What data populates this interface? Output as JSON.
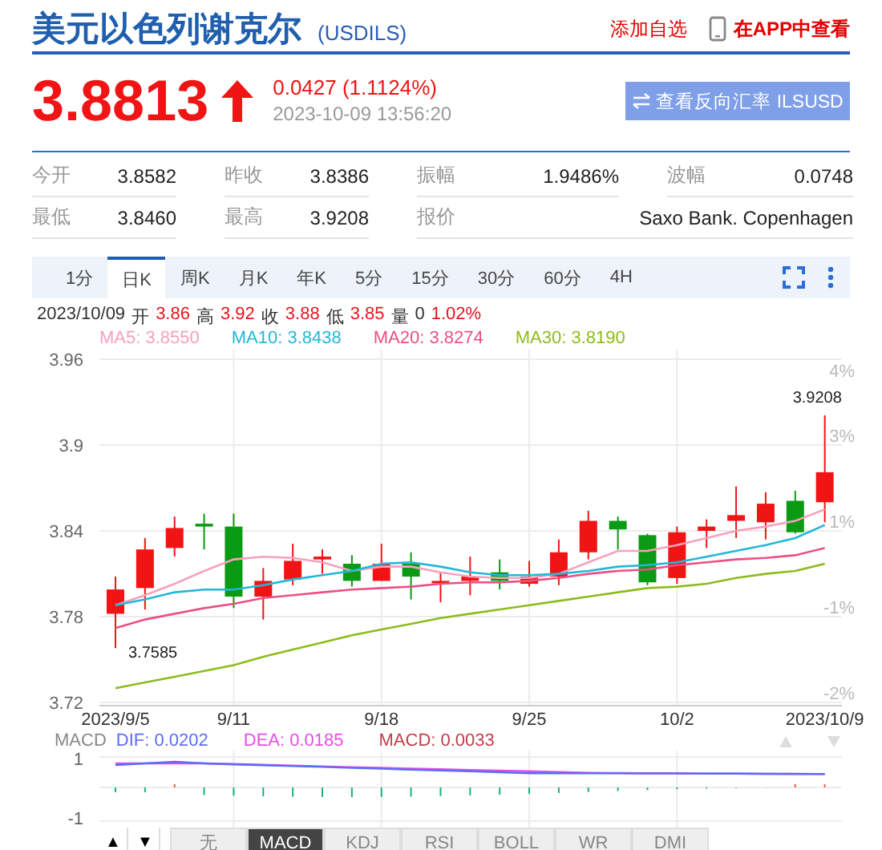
{
  "header": {
    "title": "美元以色列谢克尔",
    "code": "(USDILS)",
    "add_watchlist": "添加自选",
    "app_link": "在APP中查看"
  },
  "quote": {
    "price": "3.8813",
    "rising": true,
    "change": "0.0427 (1.1124%)",
    "time": "2023-10-09 13:56:20",
    "reverse_button": "查看反向汇率 ILSUSD"
  },
  "stats": [
    [
      {
        "label": "今开",
        "value": "3.8582"
      },
      {
        "label": "昨收",
        "value": "3.8386"
      },
      {
        "label": "振幅",
        "value": "1.9486%"
      },
      {
        "label": "波幅",
        "value": "0.0748"
      }
    ],
    [
      {
        "label": "最低",
        "value": "3.8460"
      },
      {
        "label": "最高",
        "value": "3.9208"
      },
      {
        "label": "报价",
        "value": "Saxo Bank. Copenhagen"
      }
    ]
  ],
  "periods": [
    {
      "label": "1分",
      "selected": false
    },
    {
      "label": "日K",
      "selected": true
    },
    {
      "label": "周K",
      "selected": false
    },
    {
      "label": "月K",
      "selected": false
    },
    {
      "label": "年K",
      "selected": false
    },
    {
      "label": "5分",
      "selected": false
    },
    {
      "label": "15分",
      "selected": false
    },
    {
      "label": "30分",
      "selected": false
    },
    {
      "label": "60分",
      "selected": false
    },
    {
      "label": "4H",
      "selected": false
    }
  ],
  "ohlc": {
    "date": "2023/10/09",
    "fields": [
      {
        "label": "开",
        "value": "3.86",
        "color": "#e8131b"
      },
      {
        "label": "高",
        "value": "3.92",
        "color": "#e8131b"
      },
      {
        "label": "收",
        "value": "3.88",
        "color": "#e8131b"
      },
      {
        "label": "低",
        "value": "3.85",
        "color": "#e8131b"
      },
      {
        "label": "量",
        "value": "0",
        "color": "#333333"
      }
    ],
    "change": "1.02%"
  },
  "percent_labels": [
    "4%",
    "3%",
    "1%",
    "-1%",
    "-2%"
  ],
  "chart_data": {
    "type": "candlestick",
    "ylim": [
      3.72,
      3.96
    ],
    "grid": true,
    "yticks": [
      3.72,
      3.78,
      3.84,
      3.9,
      3.96
    ],
    "categories": [
      "2023/9/5",
      null,
      null,
      null,
      "9/11",
      null,
      null,
      null,
      null,
      "9/18",
      null,
      null,
      null,
      null,
      "9/25",
      null,
      null,
      null,
      null,
      "10/2",
      null,
      null,
      null,
      null,
      "2023/10/9"
    ],
    "series": [
      {
        "name": "MA5: 3.8550",
        "type": "line",
        "color": "#f7a1bd",
        "values": [
          3.788,
          3.795,
          3.803,
          3.812,
          3.82,
          3.822,
          3.821,
          3.818,
          3.812,
          3.815,
          3.815,
          3.811,
          3.808,
          3.807,
          3.807,
          3.81,
          3.818,
          3.826,
          3.826,
          3.83,
          3.835,
          3.84,
          3.843,
          3.847,
          3.855
        ]
      },
      {
        "name": "MA10: 3.8438",
        "type": "line",
        "color": "#22b8d8",
        "values": [
          3.788,
          3.792,
          3.797,
          3.799,
          3.799,
          3.802,
          3.806,
          3.809,
          3.812,
          3.817,
          3.818,
          3.815,
          3.811,
          3.809,
          3.809,
          3.81,
          3.812,
          3.815,
          3.816,
          3.818,
          3.822,
          3.826,
          3.83,
          3.835,
          3.844
        ]
      },
      {
        "name": "MA20: 3.8274",
        "type": "line",
        "color": "#ec4f86",
        "values": [
          3.772,
          3.778,
          3.782,
          3.786,
          3.789,
          3.793,
          3.795,
          3.797,
          3.799,
          3.8,
          3.801,
          3.803,
          3.804,
          3.804,
          3.805,
          3.807,
          3.81,
          3.812,
          3.813,
          3.816,
          3.818,
          3.82,
          3.821,
          3.823,
          3.828
        ]
      },
      {
        "name": "MA30: 3.8190",
        "type": "line",
        "color": "#8ebc1c",
        "values": [
          3.73,
          3.734,
          3.738,
          3.742,
          3.746,
          3.752,
          3.757,
          3.762,
          3.767,
          3.771,
          3.775,
          3.779,
          3.782,
          3.785,
          3.788,
          3.791,
          3.794,
          3.797,
          3.8,
          3.801,
          3.803,
          3.807,
          3.81,
          3.812,
          3.817
        ]
      }
    ],
    "ohlc": [
      [
        3.782,
        3.808,
        3.758,
        3.799
      ],
      [
        3.8,
        3.835,
        3.785,
        3.827
      ],
      [
        3.828,
        3.85,
        3.822,
        3.842
      ],
      [
        3.845,
        3.852,
        3.827,
        3.843
      ],
      [
        3.843,
        3.852,
        3.786,
        3.794
      ],
      [
        3.794,
        3.814,
        3.778,
        3.805
      ],
      [
        3.806,
        3.831,
        3.802,
        3.819
      ],
      [
        3.82,
        3.827,
        3.81,
        3.822
      ],
      [
        3.817,
        3.823,
        3.801,
        3.805
      ],
      [
        3.805,
        3.831,
        3.805,
        3.817
      ],
      [
        3.817,
        3.825,
        3.792,
        3.808
      ],
      [
        3.804,
        3.811,
        3.79,
        3.805
      ],
      [
        3.805,
        3.822,
        3.795,
        3.808
      ],
      [
        3.811,
        3.82,
        3.799,
        3.805
      ],
      [
        3.803,
        3.819,
        3.801,
        3.808
      ],
      [
        3.808,
        3.834,
        3.802,
        3.825
      ],
      [
        3.825,
        3.854,
        3.82,
        3.847
      ],
      [
        3.847,
        3.85,
        3.827,
        3.841
      ],
      [
        3.837,
        3.838,
        3.802,
        3.804
      ],
      [
        3.807,
        3.843,
        3.803,
        3.839
      ],
      [
        3.84,
        3.848,
        3.828,
        3.843
      ],
      [
        3.847,
        3.871,
        3.835,
        3.851
      ],
      [
        3.846,
        3.867,
        3.834,
        3.859
      ],
      [
        3.861,
        3.868,
        3.838,
        3.839
      ],
      [
        3.86,
        3.9208,
        3.846,
        3.881
      ]
    ],
    "annotations": [
      "3.9208",
      "3.7585"
    ]
  },
  "macd": {
    "label": "MACD",
    "legend": [
      {
        "text": "DIF: 0.0202",
        "color": "#5b6cf5"
      },
      {
        "text": "DEA: 0.0185",
        "color": "#e84de8"
      },
      {
        "text": "MACD: 0.0033",
        "color": "#c0404a"
      }
    ],
    "ticks": [
      "1",
      "-1"
    ]
  },
  "scroll_buttons": [
    "▲",
    "▼"
  ],
  "indicator_tabs": [
    {
      "label": "无",
      "selected": false
    },
    {
      "label": "MACD",
      "selected": true
    },
    {
      "label": "KDJ",
      "selected": false
    },
    {
      "label": "RSI",
      "selected": false
    },
    {
      "label": "BOLL",
      "selected": false
    },
    {
      "label": "WR",
      "selected": false
    },
    {
      "label": "DMI",
      "selected": false
    }
  ]
}
